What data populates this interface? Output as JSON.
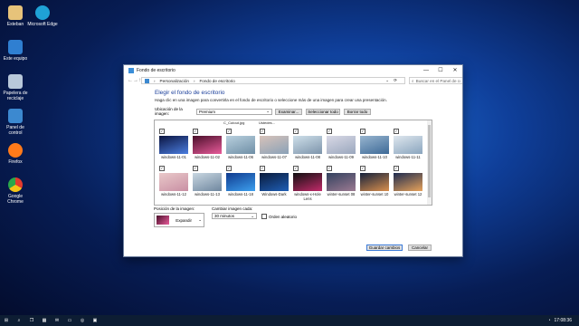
{
  "desktop": {
    "icons": [
      {
        "label": "Esteban",
        "color": "#e7c37a"
      },
      {
        "label": "Microsoft Edge",
        "color": "#1fa2d6"
      },
      {
        "label": "Este equipo",
        "color": "#2f7fd1"
      },
      {
        "label": "Papelera de reciclaje",
        "color": "#b8c8da"
      },
      {
        "label": "Panel de control",
        "color": "#3c89d0"
      },
      {
        "label": "Firefox",
        "color": "#ff7a1a"
      },
      {
        "label": "Google Chrome",
        "color": "#e33b2e"
      }
    ]
  },
  "window": {
    "title": "Fondo de escritorio",
    "controls": {
      "minimize": "—",
      "maximize": "☐",
      "close": "✕"
    },
    "breadcrumb": [
      "Personalización",
      "Fondo de escritorio"
    ],
    "search_placeholder": "Buscar en el Panel de control",
    "heading": "Elegir el fondo de escritorio",
    "subtitle": "Haga clic en una imagen para convertirla en el fondo de escritorio o seleccione más de una imagen para crear una presentación.",
    "location_label": "Ubicación de la imagen:",
    "location_value": "Premium",
    "browse_label": "Examinar...",
    "select_all_label": "Seleccionar todo",
    "clear_all_label": "Borrar todo",
    "top_row_partial": [
      "C_Cutout.jpg",
      "Ustedes..."
    ],
    "images": [
      {
        "name": "windows-11-01",
        "c1": "#0b1440",
        "c2": "#4b7ee0"
      },
      {
        "name": "windows-11-02",
        "c1": "#4a0f2a",
        "c2": "#e85b9a"
      },
      {
        "name": "windows-11-06",
        "c1": "#b9d0de",
        "c2": "#6f8fa6"
      },
      {
        "name": "windows-11-07",
        "c1": "#d8c3ba",
        "c2": "#8aa1b7"
      },
      {
        "name": "windows-11-08",
        "c1": "#cfe0ea",
        "c2": "#7d94ab"
      },
      {
        "name": "windows-11-09",
        "c1": "#d9d9e6",
        "c2": "#9aa7bd"
      },
      {
        "name": "windows-11-10",
        "c1": "#98b5cf",
        "c2": "#3e6a97"
      },
      {
        "name": "windows-11-11",
        "c1": "#dfe7ee",
        "c2": "#8aa5be"
      },
      {
        "name": "windows-11-12",
        "c1": "#e9c9c9",
        "c2": "#c98fa4"
      },
      {
        "name": "windows-11-13",
        "c1": "#c9d7e1",
        "c2": "#6f879f"
      },
      {
        "name": "windows-11-18",
        "c1": "#0f3a8e",
        "c2": "#3da0ef"
      },
      {
        "name": "Windows-Dark",
        "c1": "#0a1a3a",
        "c2": "#1f5fb6"
      },
      {
        "name": "windows-x-Hole Lens",
        "c1": "#101010",
        "c2": "#c22a6a"
      },
      {
        "name": "winter-sunset 08",
        "c1": "#32415e",
        "c2": "#9c7a92"
      },
      {
        "name": "winter-sunset 10",
        "c1": "#14213b",
        "c2": "#d98f4d"
      },
      {
        "name": "winter-sunset 12",
        "c1": "#1d2b4f",
        "c2": "#e7a25a"
      }
    ],
    "position_label": "Posición de la imagen:",
    "position_value": "Expandir",
    "change_label": "Cambiar imagen cada:",
    "change_value": "30 minutos",
    "shuffle_label": "Orden aleatorio",
    "save_label": "Guardar cambios",
    "cancel_label": "Cancelar"
  },
  "taskbar": {
    "time": "17:08:36",
    "items": [
      "start-icon",
      "search-icon",
      "task-view-icon",
      "widgets-icon",
      "chat-icon",
      "file-explorer-icon",
      "edge-icon",
      "store-icon"
    ]
  }
}
